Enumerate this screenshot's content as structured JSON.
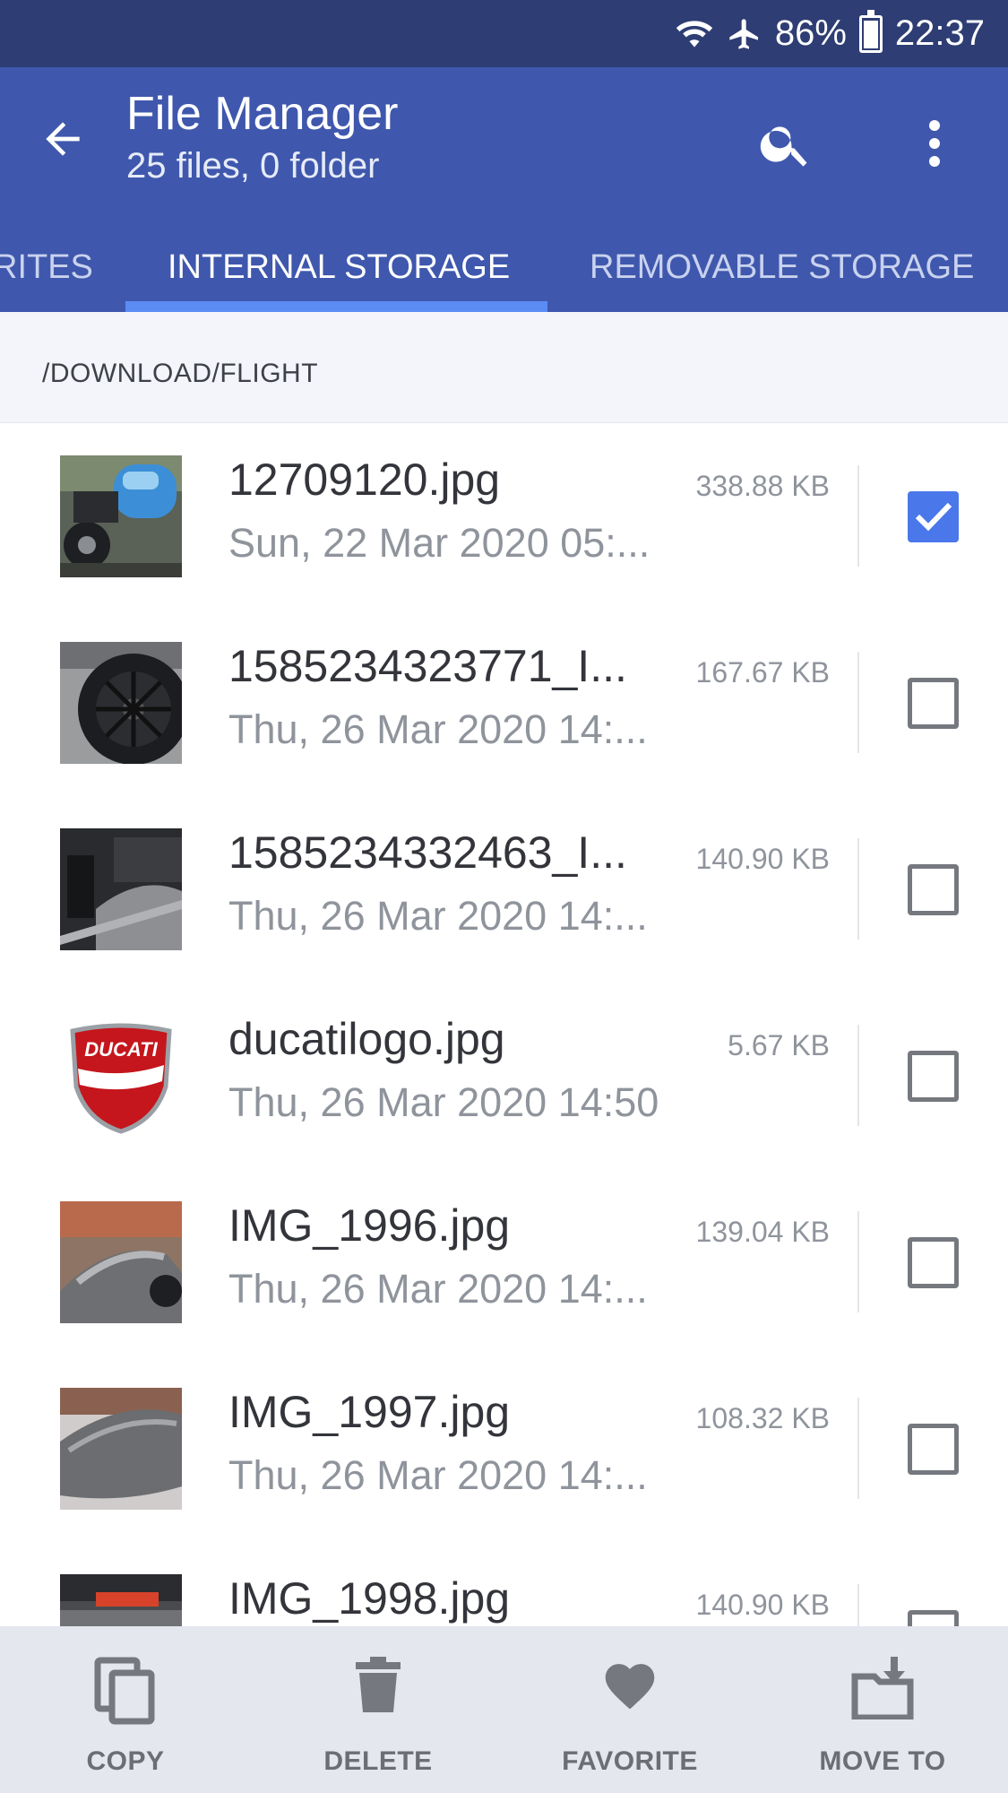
{
  "status_bar": {
    "battery": "86%",
    "time": "22:37",
    "battery_level": 0.86
  },
  "app_bar": {
    "title": "File Manager",
    "subtitle": "25 files, 0 folder"
  },
  "tabs": [
    {
      "label": "RITES"
    },
    {
      "label": "INTERNAL STORAGE"
    },
    {
      "label": "REMOVABLE STORAGE"
    }
  ],
  "path": "/DOWNLOAD/FLIGHT",
  "files": [
    {
      "name": "12709120.jpg",
      "date": "Sun, 22 Mar 2020 05:...",
      "size": "338.88 KB",
      "checked": true
    },
    {
      "name": "1585234323771_I...",
      "date": "Thu, 26 Mar 2020 14:...",
      "size": "167.67 KB",
      "checked": false
    },
    {
      "name": "1585234332463_I...",
      "date": "Thu, 26 Mar 2020 14:...",
      "size": "140.90 KB",
      "checked": false
    },
    {
      "name": "ducatilogo.jpg",
      "date": "Thu, 26 Mar 2020 14:50",
      "size": "5.67 KB",
      "checked": false
    },
    {
      "name": "IMG_1996.jpg",
      "date": "Thu, 26 Mar 2020 14:...",
      "size": "139.04 KB",
      "checked": false
    },
    {
      "name": "IMG_1997.jpg",
      "date": "Thu, 26 Mar 2020 14:...",
      "size": "108.32 KB",
      "checked": false
    },
    {
      "name": "IMG_1998.jpg",
      "date": "",
      "size": "140.90 KB",
      "checked": false
    }
  ],
  "thumbnail_logo_text": "DUCATI",
  "bottom_bar": {
    "copy": "COPY",
    "delete": "DELETE",
    "favorite": "FAVORITE",
    "move_to": "MOVE TO"
  },
  "colors": {
    "status_bar": "#2e3d73",
    "app_bar": "#3f58ad",
    "tab_indicator": "#5b8cf5",
    "checkbox_checked": "#4a78ea",
    "bottom_bar": "#e4e7ee"
  }
}
